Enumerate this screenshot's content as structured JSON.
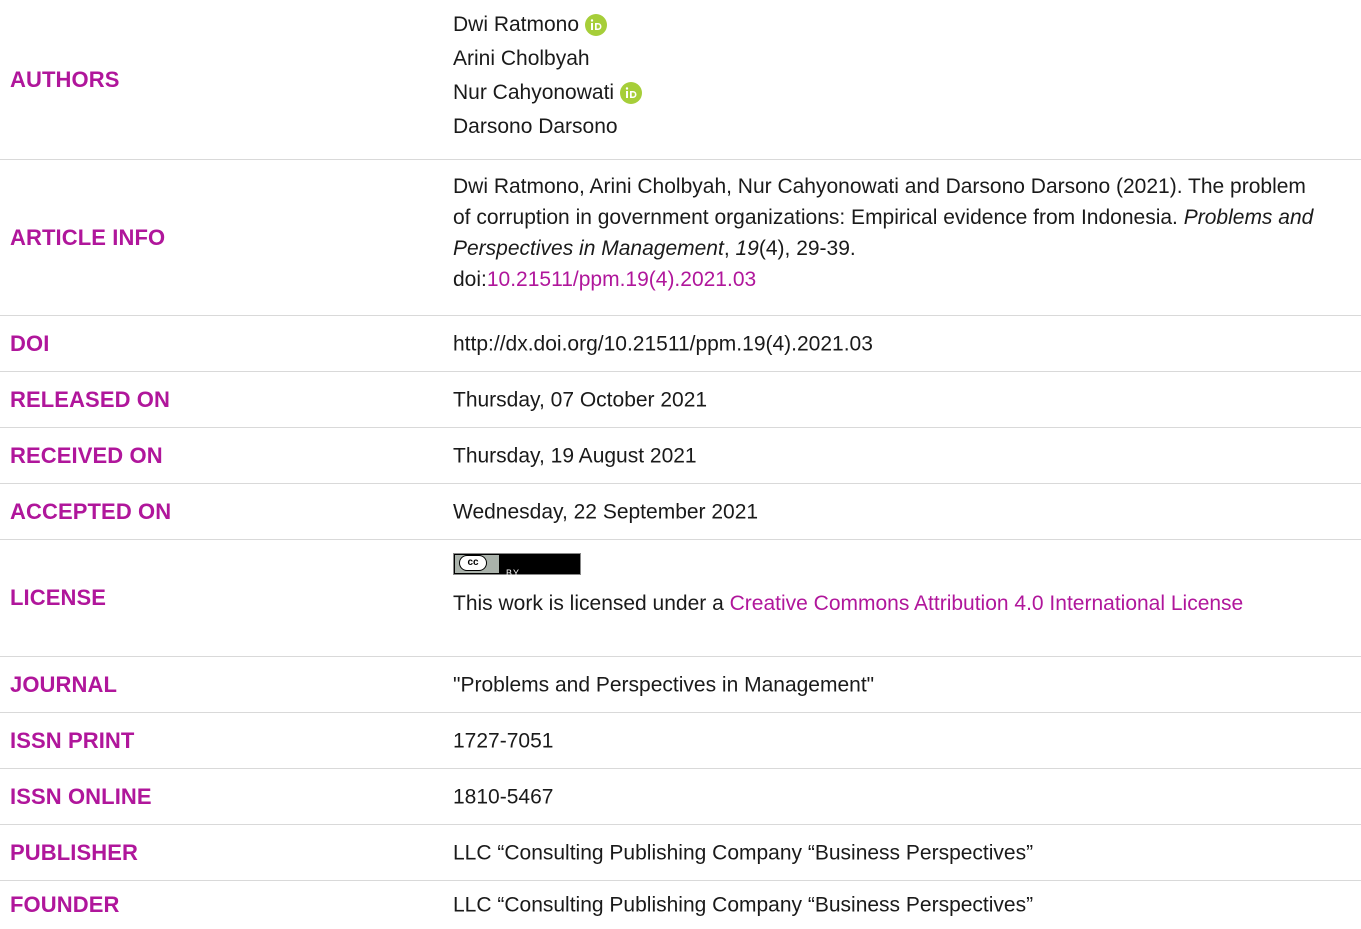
{
  "rows": {
    "authors": {
      "label": "AUTHORS",
      "names": [
        "Dwi Ratmono",
        "Arini Cholbyah",
        "Nur Cahyonowati",
        "Darsono Darsono"
      ]
    },
    "article_info": {
      "label": "ARTICLE INFO",
      "authors_year": "Dwi Ratmono, Arini Cholbyah, Nur Cahyonowati and Darsono Darsono (2021).",
      "title": "The problem of corruption in government organizations: Empirical evidence from Indonesia.",
      "journal_italic": "Problems and Perspectives in Management",
      "comma": ",",
      "volume_italic": "19",
      "issue_pages": "(4), 29-39.",
      "doi_prefix": "doi:",
      "doi_link": "10.21511/ppm.19(4).2021.03"
    },
    "doi": {
      "label": "DOI",
      "value": "http://dx.doi.org/10.21511/ppm.19(4).2021.03"
    },
    "released": {
      "label": "RELEASED ON",
      "value": "Thursday, 07 October 2021"
    },
    "received": {
      "label": "RECEIVED ON",
      "value": "Thursday, 19 August 2021"
    },
    "accepted": {
      "label": "ACCEPTED ON",
      "value": "Wednesday, 22 September 2021"
    },
    "license": {
      "label": "LICENSE",
      "badge_cc": "cc",
      "badge_by": "BY",
      "text": "This work is licensed under a ",
      "link": "Creative Commons Attribution 4.0 International License"
    },
    "journal": {
      "label": "JOURNAL",
      "value": "\"Problems and Perspectives in Management\""
    },
    "issn_print": {
      "label": "ISSN PRINT",
      "value": "1727-7051"
    },
    "issn_online": {
      "label": "ISSN ONLINE",
      "value": "1810-5467"
    },
    "publisher": {
      "label": "PUBLISHER",
      "value": "LLC “Consulting Publishing Company “Business Perspectives”"
    },
    "founder": {
      "label": "FOUNDER",
      "value": "LLC “Consulting Publishing Company “Business Perspectives”"
    }
  },
  "colors": {
    "label": "#b0169b",
    "orcid": "#a6ce39",
    "divider": "#d9d9d9"
  }
}
